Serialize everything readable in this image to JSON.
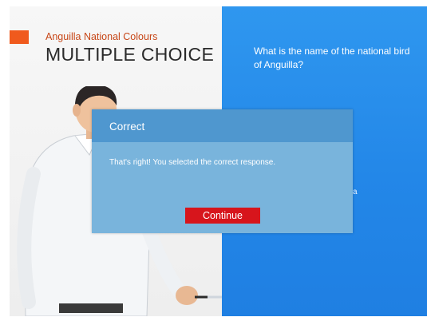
{
  "slide": {
    "subtitle": "Anguilla National Colours",
    "title": "MULTIPLE CHOICE"
  },
  "question": {
    "text": "What is the name of the  national bird of Anguilla?",
    "obscured_answer_fragment": "a"
  },
  "feedback": {
    "title": "Correct",
    "message": "That's right!  You selected the correct response.",
    "continue_label": "Continue"
  },
  "colors": {
    "accent_orange": "#f05a1d",
    "question_panel_blue": "#2387e8",
    "dialog_header_blue": "#4f97cf",
    "dialog_body_blue": "#79b4dc",
    "continue_red": "#d7151c"
  }
}
